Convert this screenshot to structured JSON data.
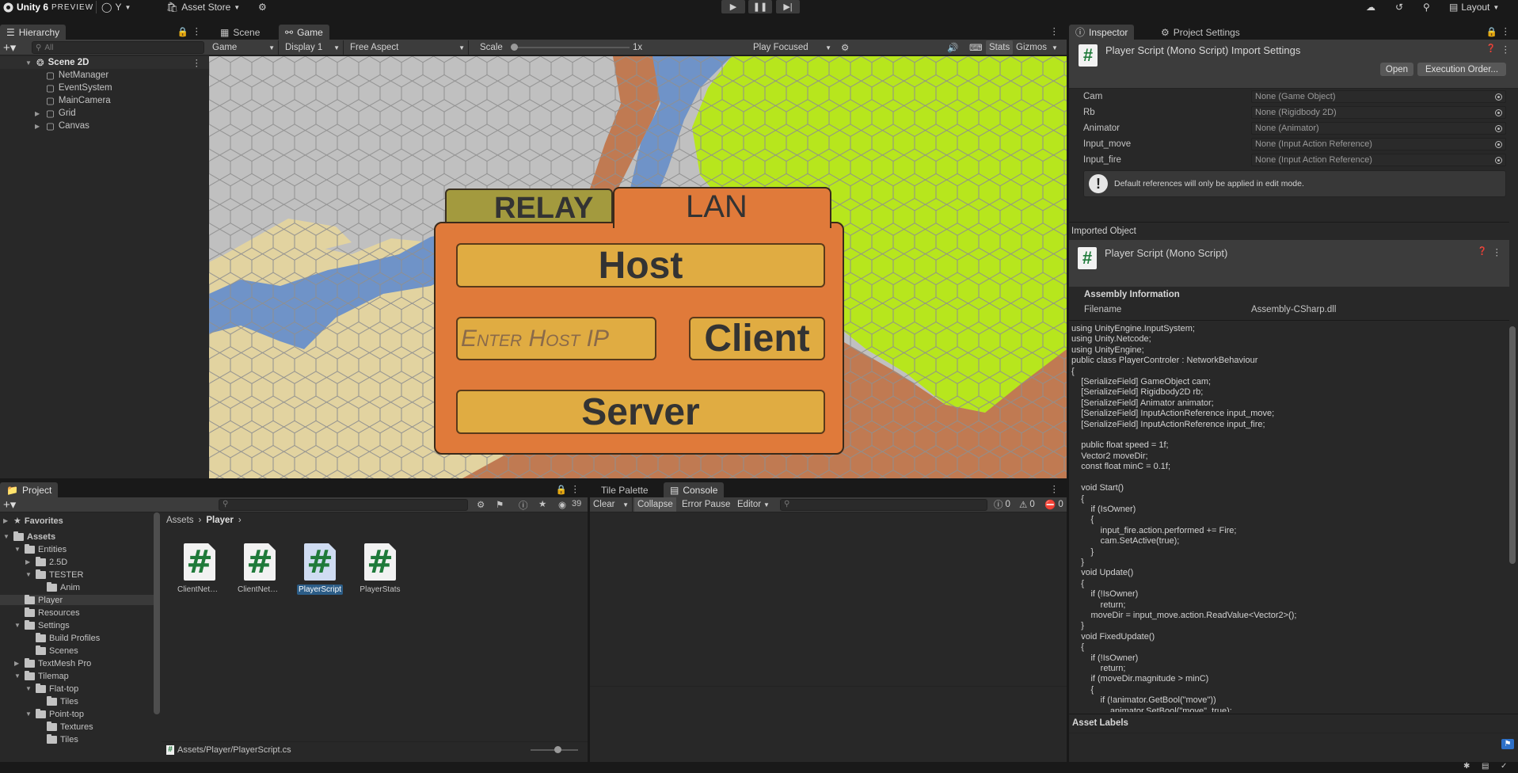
{
  "topbar": {
    "logo": "Unity 6",
    "badge": "PREVIEW",
    "account": "Y",
    "asset_store": "Asset Store",
    "layout": "Layout"
  },
  "hierarchy": {
    "tab": "Hierarchy",
    "search_placeholder": "All",
    "scene": "Scene 2D",
    "items": [
      "NetManager",
      "EventSystem",
      "MainCamera",
      "Grid",
      "Canvas"
    ]
  },
  "scene_tabs": {
    "scene": "Scene",
    "game": "Game"
  },
  "game_toolbar": {
    "view": "Game",
    "display": "Display 1",
    "aspect": "Free Aspect",
    "scale_label": "Scale",
    "scale_value": "1x",
    "play_mode": "Play Focused",
    "stats": "Stats",
    "gizmos": "Gizmos"
  },
  "game_ui": {
    "tab_relay": "RELAY",
    "tab_lan": "LAN",
    "host": "Host",
    "ip_placeholder": "Enter Host IP",
    "client": "Client",
    "server": "Server"
  },
  "colors": {
    "panel_orange": "#e07a3a",
    "button_yellow": "#e0ac42",
    "relay_tab": "#a39a3e",
    "hex_grey": "#c0c0c0",
    "hex_blue": "#6f93c8",
    "hex_sand": "#e2d3a0",
    "hex_brown": "#c07a52",
    "hex_lime": "#b7e61d",
    "script_green": "#1f7a3a"
  },
  "project": {
    "tab": "Project",
    "favorites": "Favorites",
    "assets": "Assets",
    "tree": [
      {
        "label": "Entities",
        "depth": 1,
        "arrow": "open"
      },
      {
        "label": "2.5D",
        "depth": 2,
        "arrow": "closed"
      },
      {
        "label": "TESTER",
        "depth": 2,
        "arrow": "open"
      },
      {
        "label": "Anim",
        "depth": 3,
        "arrow": ""
      },
      {
        "label": "Player",
        "depth": 1,
        "arrow": "",
        "selected": true
      },
      {
        "label": "Resources",
        "depth": 1,
        "arrow": ""
      },
      {
        "label": "Settings",
        "depth": 1,
        "arrow": "open"
      },
      {
        "label": "Build Profiles",
        "depth": 2,
        "arrow": ""
      },
      {
        "label": "Scenes",
        "depth": 2,
        "arrow": ""
      },
      {
        "label": "TextMesh Pro",
        "depth": 1,
        "arrow": "closed"
      },
      {
        "label": "Tilemap",
        "depth": 1,
        "arrow": "open"
      },
      {
        "label": "Flat-top",
        "depth": 2,
        "arrow": "open"
      },
      {
        "label": "Tiles",
        "depth": 3,
        "arrow": ""
      },
      {
        "label": "Point-top",
        "depth": 2,
        "arrow": "open"
      },
      {
        "label": "Textures",
        "depth": 3,
        "arrow": ""
      },
      {
        "label": "Tiles",
        "depth": 3,
        "arrow": ""
      }
    ],
    "breadcrumb": [
      "Assets",
      "Player"
    ],
    "count": "39",
    "files": [
      "ClientNetAn...",
      "ClientNetTra...",
      "PlayerScript",
      "PlayerStats"
    ],
    "status_path": "Assets/Player/PlayerScript.cs"
  },
  "console": {
    "tab_tile": "Tile Palette",
    "tab_console": "Console",
    "clear": "Clear",
    "collapse": "Collapse",
    "error_pause": "Error Pause",
    "editor": "Editor",
    "info_count": "0",
    "warn_count": "0",
    "error_count": "0"
  },
  "inspector": {
    "tab_inspector": "Inspector",
    "tab_settings": "Project Settings",
    "title": "Player Script (Mono Script) Import Settings",
    "open": "Open",
    "execution_order": "Execution Order...",
    "props": [
      {
        "name": "Cam",
        "value": "None (Game Object)"
      },
      {
        "name": "Rb",
        "value": "None (Rigidbody 2D)"
      },
      {
        "name": "Animator",
        "value": "None (Animator)"
      },
      {
        "name": "Input_move",
        "value": "None (Input Action Reference)"
      },
      {
        "name": "Input_fire",
        "value": "None (Input Action Reference)"
      }
    ],
    "warning": "Default references will only be applied in edit mode.",
    "imported_header": "Imported Object",
    "imported_name": "Player Script (Mono Script)",
    "assembly_header": "Assembly Information",
    "filename_label": "Filename",
    "filename_value": "Assembly-CSharp.dll",
    "code": "using UnityEngine.InputSystem;\nusing Unity.Netcode;\nusing UnityEngine;\npublic class PlayerControler : NetworkBehaviour\n{\n    [SerializeField] GameObject cam;\n    [SerializeField] Rigidbody2D rb;\n    [SerializeField] Animator animator;\n    [SerializeField] InputActionReference input_move;\n    [SerializeField] InputActionReference input_fire;\n\n    public float speed = 1f;\n    Vector2 moveDir;\n    const float minC = 0.1f;\n\n    void Start()\n    {\n        if (IsOwner)\n        {\n            input_fire.action.performed += Fire;\n            cam.SetActive(true);\n        }\n    }\n    void Update()\n    {\n        if (!IsOwner)\n            return;\n        moveDir = input_move.action.ReadValue<Vector2>();\n    }\n    void FixedUpdate()\n    {\n        if (!IsOwner)\n            return;\n        if (moveDir.magnitude > minC)\n        {\n            if (!animator.GetBool(\"move\"))\n                animator.SetBool(\"move\", true);",
    "asset_labels": "Asset Labels"
  }
}
